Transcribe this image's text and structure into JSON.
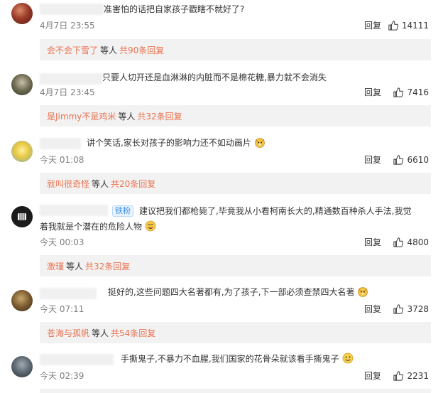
{
  "comments": [
    {
      "text": "准害怕的话把自家孩子戳瞎不就好了?",
      "time": "4月7日 23:55",
      "reply_label": "回复",
      "likes": "14111",
      "sub_user": "会不会下雪了",
      "sub_mid": "等人",
      "sub_count": "共90条回复",
      "avatar_color": "#7a2a1e"
    },
    {
      "text": "只要人切开还是血淋淋的内脏而不是棉花糖,暴力就不会消失",
      "time": "4月7日 23:45",
      "reply_label": "回复",
      "likes": "7416",
      "sub_user": "是Jimmy不是鸡米",
      "sub_mid": "等人",
      "sub_count": "共32条回复",
      "avatar_color": "#4a5a3c"
    },
    {
      "text": "讲个笑话,家长对孩子的影响力还不如动画片",
      "time": "今天 01:08",
      "reply_label": "回复",
      "likes": "6610",
      "sub_user": "就叫很奇怪",
      "sub_mid": "等人",
      "sub_count": "共20条回复",
      "avatar_color": "#d9c24a"
    },
    {
      "badge": "铁粉",
      "text_line1": "建议把我们都枪毙了,毕竟我从小看柯南长大的,精通数百种杀人手法,我觉",
      "text_line2": "着我就是个潜在的危险人物",
      "time": "今天 00:03",
      "reply_label": "回复",
      "likes": "4800",
      "sub_user": "激瑾",
      "sub_mid": "等人",
      "sub_count": "共32条回复",
      "avatar_color": "#222222"
    },
    {
      "text": "挺好的,这些问题四大名著都有,为了孩子,下一部必须查禁四大名著",
      "time": "今天 07:11",
      "reply_label": "回复",
      "likes": "3728",
      "sub_user": "苍海与孤帆",
      "sub_mid": "等人",
      "sub_count": "共54条回复",
      "avatar_color": "#6b4a2a"
    },
    {
      "text": "手撕鬼子,不暴力不血腥,我们国家的花骨朵就该看手撕鬼子",
      "time": "今天 02:39",
      "reply_label": "回复",
      "likes": "2231",
      "avatar_color": "#5a6670"
    }
  ]
}
